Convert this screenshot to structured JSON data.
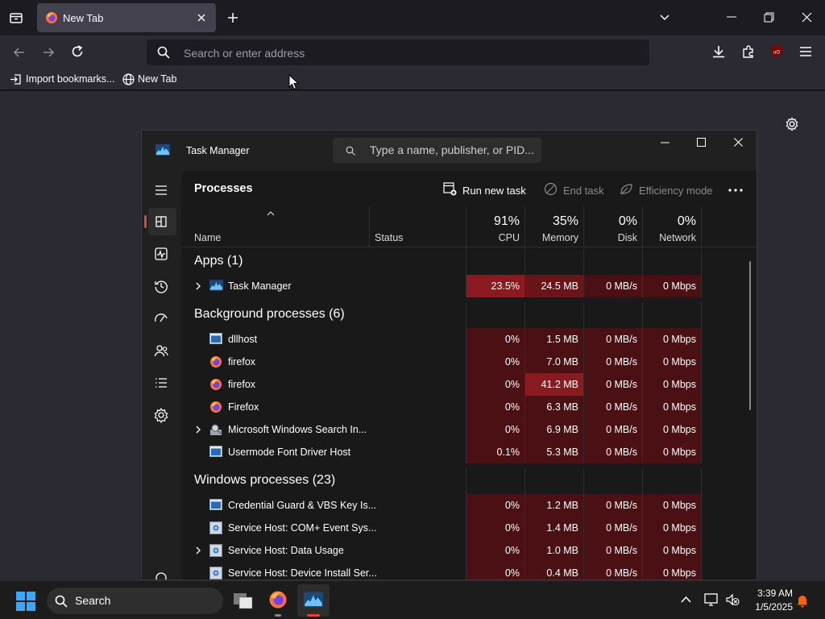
{
  "browser": {
    "tab_title": "New Tab",
    "address_placeholder": "Search or enter address",
    "bookmarks": [
      "Import bookmarks...",
      "New Tab"
    ],
    "colors": {
      "tab_active": "#42414d",
      "toolbar": "#2b2a33",
      "frame": "#1c1b22"
    }
  },
  "task_manager": {
    "title": "Task Manager",
    "search_placeholder": "Type a name, publisher, or PID...",
    "page_title": "Processes",
    "toolbar": {
      "run_new_task": "Run new task",
      "end_task": "End task",
      "efficiency_mode": "Efficiency mode"
    },
    "columns": {
      "name": "Name",
      "status": "Status",
      "cpu": {
        "pct": "91%",
        "label": "CPU"
      },
      "memory": {
        "pct": "35%",
        "label": "Memory"
      },
      "disk": {
        "pct": "0%",
        "label": "Disk"
      },
      "network": {
        "pct": "0%",
        "label": "Network"
      }
    },
    "groups": {
      "apps": "Apps (1)",
      "background": "Background processes (6)",
      "windows": "Windows processes (23)"
    },
    "processes": {
      "task_manager": {
        "name": "Task Manager",
        "cpu": "23.5%",
        "memory": "24.5 MB",
        "disk": "0 MB/s",
        "network": "0 Mbps"
      },
      "dllhost": {
        "name": "dllhost",
        "cpu": "0%",
        "memory": "1.5 MB",
        "disk": "0 MB/s",
        "network": "0 Mbps"
      },
      "firefox1": {
        "name": "firefox",
        "cpu": "0%",
        "memory": "7.0 MB",
        "disk": "0 MB/s",
        "network": "0 Mbps"
      },
      "firefox2": {
        "name": "firefox",
        "cpu": "0%",
        "memory": "41.2 MB",
        "disk": "0 MB/s",
        "network": "0 Mbps"
      },
      "firefox3": {
        "name": "Firefox",
        "cpu": "0%",
        "memory": "6.3 MB",
        "disk": "0 MB/s",
        "network": "0 Mbps"
      },
      "search_indexer": {
        "name": "Microsoft Windows Search In...",
        "cpu": "0%",
        "memory": "6.9 MB",
        "disk": "0 MB/s",
        "network": "0 Mbps"
      },
      "font_host": {
        "name": "Usermode Font Driver Host",
        "cpu": "0.1%",
        "memory": "5.3 MB",
        "disk": "0 MB/s",
        "network": "0 Mbps"
      },
      "cred_guard": {
        "name": "Credential Guard & VBS Key Is...",
        "cpu": "0%",
        "memory": "1.2 MB",
        "disk": "0 MB/s",
        "network": "0 Mbps"
      },
      "svc_com": {
        "name": "Service Host: COM+ Event Sys...",
        "cpu": "0%",
        "memory": "1.4 MB",
        "disk": "0 MB/s",
        "network": "0 Mbps"
      },
      "svc_data": {
        "name": "Service Host: Data Usage",
        "cpu": "0%",
        "memory": "1.0 MB",
        "disk": "0 MB/s",
        "network": "0 Mbps"
      },
      "svc_device": {
        "name": "Service Host: Device Install Ser...",
        "cpu": "0%",
        "memory": "0.4 MB",
        "disk": "0 MB/s",
        "network": "0 Mbps"
      }
    },
    "colors": {
      "heat_low": "#4a1014",
      "heat_mid": "#6b1418",
      "heat_high": "#8a1a1f",
      "accent": "#e8403c"
    }
  },
  "taskbar": {
    "search_label": "Search",
    "time": "3:39 AM",
    "date": "1/5/2025"
  }
}
